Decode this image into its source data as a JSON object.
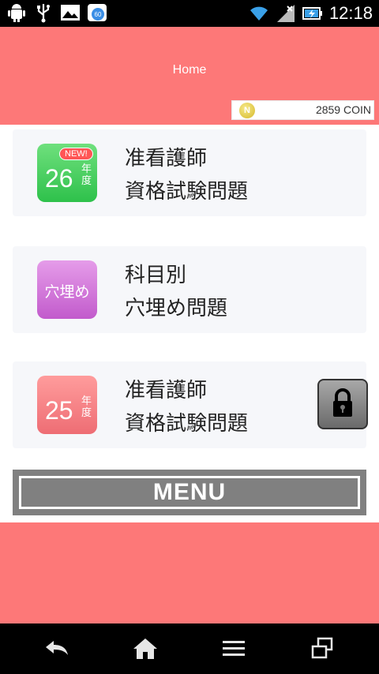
{
  "status_bar": {
    "time": "12:18",
    "left_icons": [
      "android-debug-icon",
      "usb-icon",
      "image-icon",
      "notification-60-icon"
    ],
    "notification_badge": "60",
    "right_icons": [
      "wifi-icon",
      "signal-icon",
      "battery-charging-icon"
    ]
  },
  "header": {
    "title": "Home",
    "coin_icon_letter": "N",
    "coins": "2859 COIN"
  },
  "cards": [
    {
      "icon_color": "#3cc95a",
      "badge": "NEW!",
      "icon_number": "26",
      "icon_suffix": "年度",
      "line1": "准看護師",
      "line2": "資格試験問題",
      "locked": false
    },
    {
      "icon_color": "#d073d8",
      "icon_text": "穴埋め",
      "line1": "科目別",
      "line2": "穴埋め問題",
      "locked": false
    },
    {
      "icon_color": "#f47d82",
      "icon_number": "25",
      "icon_suffix": "年度",
      "line1": "准看護師",
      "line2": "資格試験問題",
      "locked": true
    }
  ],
  "menu_label": "MENU",
  "nav": [
    "back-icon",
    "home-icon",
    "menu-icon",
    "recent-apps-icon"
  ],
  "colors": {
    "header_bg": "#fd7878",
    "status_bg": "#000000",
    "menu_bg": "#808080"
  }
}
